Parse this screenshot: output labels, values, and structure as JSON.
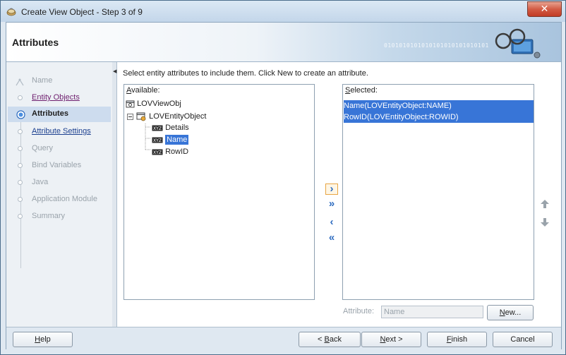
{
  "window": {
    "title": "Create View Object - Step 3 of 9",
    "close_glyph": "✕"
  },
  "header": {
    "title": "Attributes",
    "binary_text": "0101010101010101010101010101"
  },
  "nav": {
    "steps": [
      {
        "label": "Name",
        "state": "disabled"
      },
      {
        "label": "Entity Objects",
        "state": "visited"
      },
      {
        "label": "Attributes",
        "state": "active"
      },
      {
        "label": "Attribute Settings",
        "state": "link"
      },
      {
        "label": "Query",
        "state": "disabled"
      },
      {
        "label": "Bind Variables",
        "state": "disabled"
      },
      {
        "label": "Java",
        "state": "disabled"
      },
      {
        "label": "Application Module",
        "state": "disabled"
      },
      {
        "label": "Summary",
        "state": "disabled"
      }
    ]
  },
  "content": {
    "instruction": "Select entity attributes to include them.  Click New to create an attribute.",
    "available_label": "Available:",
    "selected_label": "Selected:",
    "tree": {
      "root": "LOVViewObj",
      "entity": "LOVEntityObject",
      "attributes": [
        "Details",
        "Name",
        "RowID"
      ],
      "selected_attribute": "Name"
    },
    "selected_items": [
      "Name(LOVEntityObject:NAME)",
      "RowID(LOVEntityObject:ROWID)"
    ],
    "attribute_field": {
      "label": "Attribute:",
      "value": "Name"
    },
    "new_button": "New..."
  },
  "footer": {
    "help": "Help",
    "back": "< Back",
    "next": "Next >",
    "finish": "Finish",
    "cancel": "Cancel"
  },
  "colors": {
    "selection": "#3875d7",
    "title_gradient": "#c3d6ea",
    "close_button": "#c13b25",
    "active_step_bg": "#cddcee"
  },
  "icons": [
    "app-icon",
    "close-icon",
    "wizard-header-icon",
    "view-object-icon",
    "entity-object-icon",
    "attribute-icon",
    "move-right-icon",
    "move-all-right-icon",
    "move-left-icon",
    "move-all-left-icon",
    "move-up-icon",
    "move-down-icon"
  ]
}
